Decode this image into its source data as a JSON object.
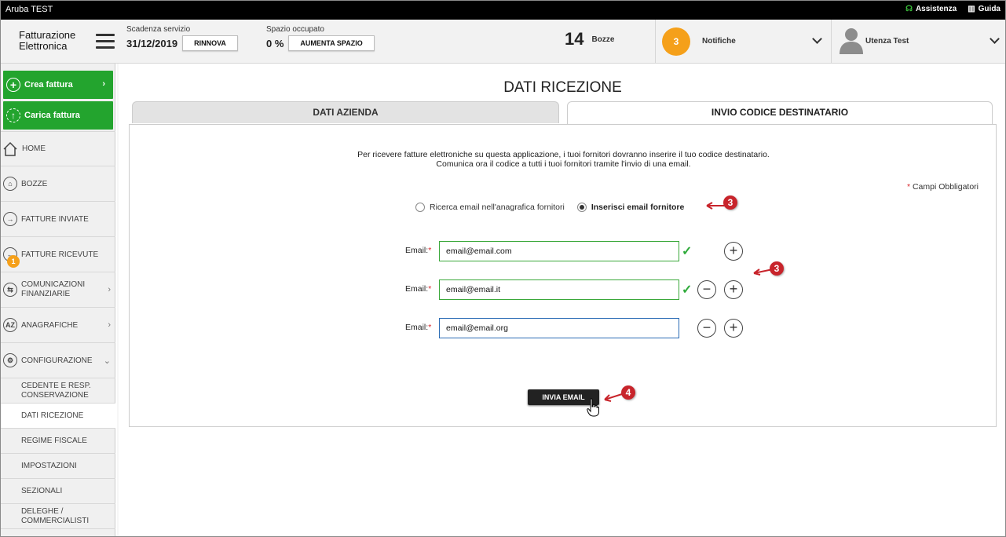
{
  "app": {
    "window_title": "Aruba TEST",
    "assist_label": "Assistenza",
    "guide_label": "Guida"
  },
  "header": {
    "logo_line1": "Fatturazione",
    "logo_line2": "Elettronica",
    "expiry_label": "Scadenza servizio",
    "expiry_date": "31/12/2019",
    "renew_btn": "RINNOVA",
    "space_label": "Spazio occupato",
    "space_value": "0 %",
    "space_btn": "AUMENTA SPAZIO",
    "drafts_count": "14",
    "drafts_label": "Bozze",
    "notif_count": "3",
    "notif_label": "Notifiche",
    "user_label": "Utenza Test"
  },
  "sidebar": {
    "create_btn": "Crea fattura",
    "upload_btn": "Carica fattura",
    "items": [
      {
        "label": "HOME"
      },
      {
        "label": "BOZZE"
      },
      {
        "label": "FATTURE INVIATE"
      },
      {
        "label": "FATTURE RICEVUTE",
        "badge": "1"
      },
      {
        "label1": "COMUNICAZIONI",
        "label2": "FINANZIARIE"
      },
      {
        "label": "ANAGRAFICHE"
      },
      {
        "label": "CONFIGURAZIONE"
      }
    ],
    "sub_items": [
      {
        "label1": "CEDENTE E RESP.",
        "label2": "CONSERVAZIONE"
      },
      {
        "label": "DATI RICEZIONE"
      },
      {
        "label": "REGIME FISCALE"
      },
      {
        "label": "IMPOSTAZIONI"
      },
      {
        "label": "SEZIONALI"
      },
      {
        "label1": "DELEGHE /",
        "label2": "COMMERCIALISTI"
      }
    ]
  },
  "main": {
    "title": "DATI RICEZIONE",
    "tabs": [
      {
        "label": "DATI AZIENDA"
      },
      {
        "label": "INVIO CODICE DESTINATARIO"
      }
    ],
    "info_line1": "Per ricevere fatture elettroniche su questa applicazione, i tuoi fornitori dovranno inserire il tuo codice destinatario.",
    "info_line2": "Comunica ora il codice a tutti i tuoi fornitori tramite l'invio di una email.",
    "required_note": "Campi Obbligatori",
    "radio_search": "Ricerca email nell'anagrafica fornitori",
    "radio_insert": "Inserisci email fornitore",
    "email_label": "Email:",
    "emails": [
      "email@email.com",
      "email@email.it",
      "email@email.org"
    ],
    "send_btn": "INVIA EMAIL"
  },
  "annotations": [
    "3",
    "3",
    "4"
  ],
  "colors": {
    "green": "#23a42e",
    "orange": "#f5a01a",
    "annotation_red": "#c8242b",
    "dark": "#222222"
  }
}
